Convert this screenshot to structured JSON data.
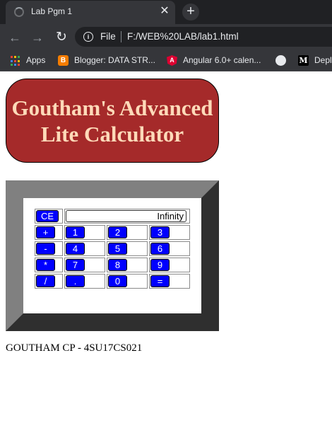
{
  "browser": {
    "tab": {
      "title": "Lab Pgm 1",
      "close_glyph": "✕",
      "favicon": "page-loading-icon"
    },
    "new_tab_glyph": "+",
    "nav": {
      "back_glyph": "←",
      "forward_glyph": "→",
      "reload_glyph": "↻"
    },
    "address_bar": {
      "info_glyph": "i",
      "scheme_label": "File",
      "url": "F:/WEB%20LAB/lab1.html"
    },
    "bookmarks": [
      {
        "label": "Apps",
        "icon": "apps-grid-icon"
      },
      {
        "label": "Blogger: DATA STR...",
        "icon": "blogger-icon"
      },
      {
        "label": "Angular 6.0+ calen...",
        "icon": "angular-icon"
      },
      {
        "label": "",
        "icon": "globe-icon"
      },
      {
        "label": "Depl",
        "icon": "medium-icon"
      }
    ],
    "icon_glyphs": {
      "blogger": "B",
      "angular": "A",
      "medium": "M"
    }
  },
  "heading": {
    "line1": "Goutham's Advanced",
    "line2": "Lite Calculator"
  },
  "calculator": {
    "clear_label": "CE",
    "display_value": "Infinity",
    "rows": [
      [
        "+",
        "1",
        "2",
        "3"
      ],
      [
        "-",
        "4",
        "5",
        "6"
      ],
      [
        "*",
        "7",
        "8",
        "9"
      ],
      [
        "/",
        ".",
        "0",
        "="
      ]
    ]
  },
  "footer": {
    "text": "GOUTHAM CP - 4SU17CS021"
  },
  "colors": {
    "heading_bg": "#a52a2a",
    "heading_text": "#ffdab9",
    "button_bg": "#0000ff",
    "button_text": "#ffffff",
    "frame_light": "#808080",
    "frame_dark": "#2f2f2f"
  }
}
